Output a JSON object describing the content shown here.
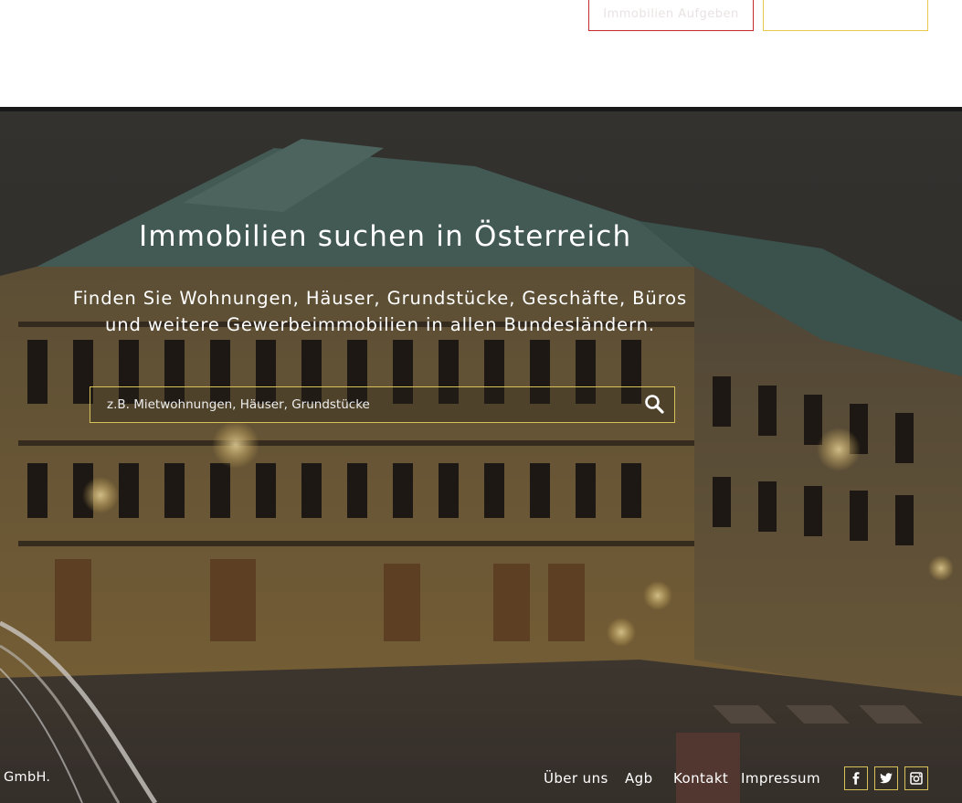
{
  "top_buttons": {
    "left_label": "Immobilien Aufgeben",
    "right_label": ""
  },
  "hero": {
    "title": "Immobilien suchen in Österreich",
    "subtitle_line1": "Finden Sie Wohnungen, Häuser, Grundstücke, Geschäfte, Büros",
    "subtitle_line2": "und weitere Gewerbeimmobilien in allen Bundesländern."
  },
  "search": {
    "placeholder": "z.B. Mietwohnungen, Häuser, Grundstücke",
    "value": ""
  },
  "footer": {
    "company_fragment": "GmbH.",
    "links": [
      "Über uns",
      "Agb",
      "Kontakt",
      "Impressum"
    ],
    "social_icons": [
      "facebook-icon",
      "twitter-icon",
      "instagram-icon"
    ]
  },
  "colors": {
    "accent_gold": "#d8c25a",
    "accent_red": "#c62b2b",
    "text_light": "#ffffff"
  }
}
